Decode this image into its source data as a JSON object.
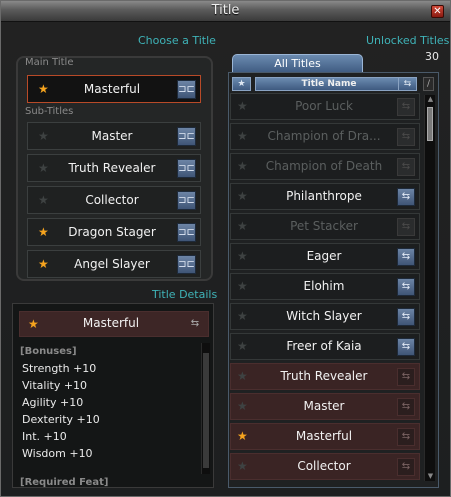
{
  "window": {
    "title": "Title",
    "close_glyph": "✕"
  },
  "headers": {
    "choose_title": "Choose a Title",
    "unlocked_titles": "Unlocked Titles",
    "unlocked_count": "30",
    "title_details": "Title Details"
  },
  "left": {
    "main_title_label": "Main Title",
    "main_title": {
      "name": "Masterful",
      "starred": true
    },
    "sub_titles_label": "Sub-Titles",
    "sub_titles": [
      {
        "name": "Master",
        "starred": false
      },
      {
        "name": "Truth Revealer",
        "starred": false
      },
      {
        "name": "Collector",
        "starred": false
      },
      {
        "name": "Dragon Stager",
        "starred": true
      },
      {
        "name": "Angel Slayer",
        "starred": true
      }
    ],
    "remove_button_glyph": "⊐⊏"
  },
  "details": {
    "name": "Masterful",
    "starred": true,
    "bonuses_label": "[Bonuses]",
    "bonuses": [
      "Strength +10",
      "Vitality +10",
      "Agility +10",
      "Dexterity +10",
      "Int. +10",
      "Wisdom +10"
    ],
    "required_label": "[Required Feat]"
  },
  "right": {
    "tab_label": "All Titles",
    "column_star": "★",
    "column_name": "Title Name",
    "column_sort": "⇆",
    "column_edit": "/",
    "add_button_glyph": "⇆",
    "titles": [
      {
        "name": "Poor Luck",
        "state": "locked",
        "starred": false
      },
      {
        "name": "Champion of Dra...",
        "state": "locked",
        "starred": false
      },
      {
        "name": "Champion of Death",
        "state": "locked",
        "starred": false
      },
      {
        "name": "Philanthrope",
        "state": "available",
        "starred": false
      },
      {
        "name": "Pet Stacker",
        "state": "locked",
        "starred": false
      },
      {
        "name": "Eager",
        "state": "available",
        "starred": false
      },
      {
        "name": "Elohim",
        "state": "available",
        "starred": false
      },
      {
        "name": "Witch Slayer",
        "state": "available",
        "starred": false
      },
      {
        "name": "Freer of Kaia",
        "state": "available",
        "starred": false
      },
      {
        "name": "Truth Revealer",
        "state": "owned",
        "starred": false
      },
      {
        "name": "Master",
        "state": "owned",
        "starred": false
      },
      {
        "name": "Masterful",
        "state": "owned",
        "starred": true
      },
      {
        "name": "Collector",
        "state": "owned",
        "starred": false
      }
    ]
  }
}
